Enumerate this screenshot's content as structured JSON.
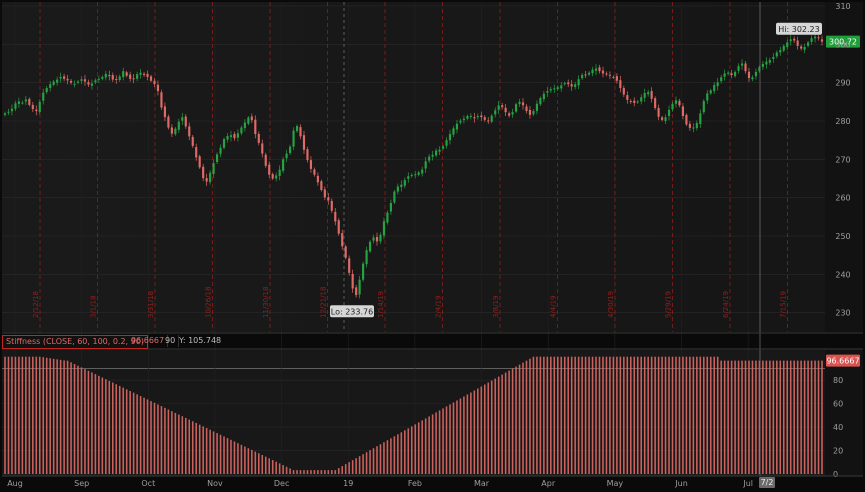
{
  "colors": {
    "background": "#171717",
    "grid": "#2a2a2a",
    "bull": "#26a343",
    "bear": "#e06a66",
    "marker": "#b3211c",
    "axis_text": "#9e9e9e",
    "last_badge": "#1f9e3a",
    "study_badge": "#d9534f"
  },
  "chart_data": [
    {
      "type": "candlestick",
      "title": "",
      "price_axis": {
        "ticks": [
          230,
          240,
          250,
          260,
          270,
          280,
          290,
          300,
          310
        ],
        "range": [
          226,
          310
        ]
      },
      "x_month_labels": [
        "Aug",
        "Sep",
        "Oct",
        "Nov",
        "Dec",
        "19",
        "Feb",
        "Mar",
        "Apr",
        "May",
        "Jun",
        "Jul"
      ],
      "closes": [
        282.0,
        282.4,
        283.2,
        284.6,
        285.1,
        284.8,
        285.6,
        284.2,
        283.1,
        282.6,
        285.0,
        287.4,
        288.6,
        289.6,
        290.3,
        290.8,
        291.5,
        291.0,
        290.6,
        290.0,
        289.7,
        290.3,
        290.9,
        290.3,
        289.5,
        289.8,
        290.6,
        291.0,
        291.5,
        292.3,
        291.7,
        290.8,
        290.7,
        291.6,
        293.0,
        291.8,
        291.0,
        291.0,
        292.2,
        292.6,
        292.0,
        291.5,
        290.5,
        289.6,
        287.8,
        283.5,
        281.0,
        278.3,
        276.7,
        278.0,
        279.8,
        281.0,
        278.6,
        276.0,
        273.5,
        270.5,
        267.9,
        265.1,
        264.2,
        266.5,
        269.0,
        271.3,
        273.0,
        275.3,
        276.1,
        276.3,
        275.5,
        276.8,
        278.3,
        279.6,
        280.9,
        280.2,
        276.6,
        274.3,
        271.5,
        268.3,
        266.0,
        265.0,
        265.8,
        267.3,
        270.0,
        271.5,
        273.3,
        277.5,
        278.7,
        276.0,
        272.5,
        269.8,
        267.5,
        266.0,
        264.0,
        262.0,
        260.1,
        259.3,
        256.6,
        253.8,
        250.6,
        247.3,
        244.3,
        240.4,
        236.3,
        234.6,
        238.6,
        242.8,
        246.3,
        248.5,
        249.6,
        248.6,
        250.3,
        253.8,
        256.1,
        258.6,
        261.6,
        262.9,
        263.4,
        264.6,
        265.6,
        265.9,
        266.1,
        266.6,
        267.3,
        269.5,
        270.7,
        271.2,
        272.3,
        272.5,
        273.4,
        275.0,
        276.6,
        278.1,
        279.3,
        280.1,
        280.6,
        281.3,
        281.3,
        280.7,
        281.3,
        281.0,
        280.3,
        280.1,
        281.4,
        282.8,
        284.1,
        283.6,
        282.3,
        281.4,
        282.3,
        284.4,
        285.0,
        284.1,
        282.6,
        281.6,
        282.6,
        284.5,
        286.0,
        287.1,
        287.8,
        288.3,
        288.5,
        288.8,
        289.3,
        289.9,
        289.6,
        289.0,
        289.6,
        290.9,
        292.0,
        292.1,
        292.6,
        293.4,
        293.7,
        293.0,
        292.4,
        292.2,
        291.8,
        291.4,
        290.5,
        288.6,
        286.9,
        285.5,
        285.0,
        284.7,
        285.1,
        286.2,
        287.3,
        287.5,
        285.8,
        283.4,
        281.1,
        280.3,
        281.0,
        282.9,
        284.5,
        285.4,
        284.1,
        281.3,
        279.1,
        278.2,
        278.3,
        279.5,
        282.0,
        285.2,
        287.2,
        288.0,
        289.4,
        290.1,
        291.4,
        292.4,
        292.6,
        292.0,
        292.8,
        294.3,
        295.0,
        293.0,
        291.2,
        291.4,
        292.8,
        294.1,
        294.9,
        295.5,
        295.9,
        296.7,
        297.9,
        298.5,
        299.6,
        300.5,
        301.3,
        301.0,
        299.6,
        298.9,
        299.3,
        300.5,
        301.6,
        302.0,
        301.6,
        300.7
      ],
      "high": 302.23,
      "low": 233.76,
      "last": 300.72,
      "high_label": "Hi: 302.23",
      "low_label": "Lo: 233.76",
      "last_label": "300.72",
      "vertical_marker_labels": [
        "2/12/18",
        "3/1/18",
        "3/31/18",
        "10/26/18",
        "11/30/18",
        "12/21/18",
        "1/14/19",
        "2/4/19",
        "3/8/19",
        "4/4/19",
        "4/30/19",
        "5/29/19",
        "6/24/19",
        "7/15/19"
      ]
    },
    {
      "type": "bar",
      "title": "Stiffness (CLOSE, 60, 100, 0.2, 90)",
      "y_axis": {
        "ticks": [
          0,
          20,
          40,
          60,
          80
        ],
        "range": [
          0,
          104
        ]
      },
      "threshold": 90,
      "legend_value": "96.6667",
      "legend_threshold": "90",
      "legend_y": "Y: 105.748",
      "last_badge": "96.6667",
      "plateau_start": 100,
      "decline_end": 65,
      "bottom": 3.3,
      "rise_start": 80,
      "rise_end": 152
    }
  ],
  "footer": {
    "date_badge": "7/2"
  }
}
